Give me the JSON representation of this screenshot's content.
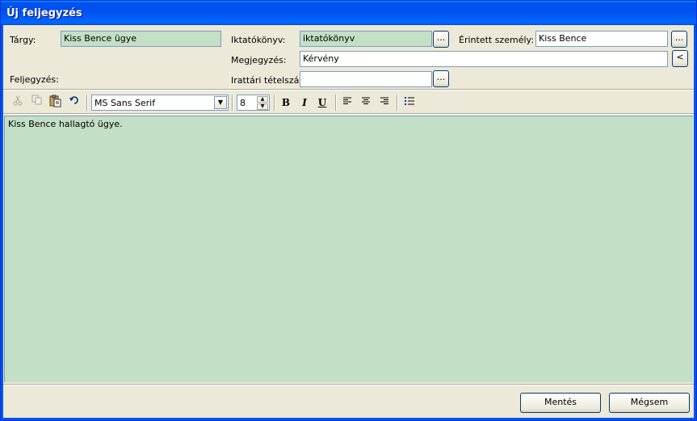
{
  "window": {
    "title": "Új feljegyzés"
  },
  "form": {
    "subject_label": "Tárgy:",
    "subject_value": "Kiss Bence ügye",
    "registry_label": "Iktatókönyv:",
    "registry_value": "iktatókönyv",
    "person_label": "Érintett személy:",
    "person_value": "Kiss Bence",
    "note_label": "Megjegyzés:",
    "note_value": "Kérvény",
    "record_label": "Feljegyzés:",
    "archive_label": "Irattári tételszám:",
    "archive_value": "",
    "browse_label": "...",
    "back_label": "<"
  },
  "toolbar": {
    "font_name": "MS Sans Serif",
    "font_size": "8",
    "bold": "B",
    "italic": "I",
    "underline": "U"
  },
  "editor": {
    "text": "Kiss Bence hallagtó ügye."
  },
  "buttons": {
    "save": "Mentés",
    "cancel": "Mégsem"
  }
}
